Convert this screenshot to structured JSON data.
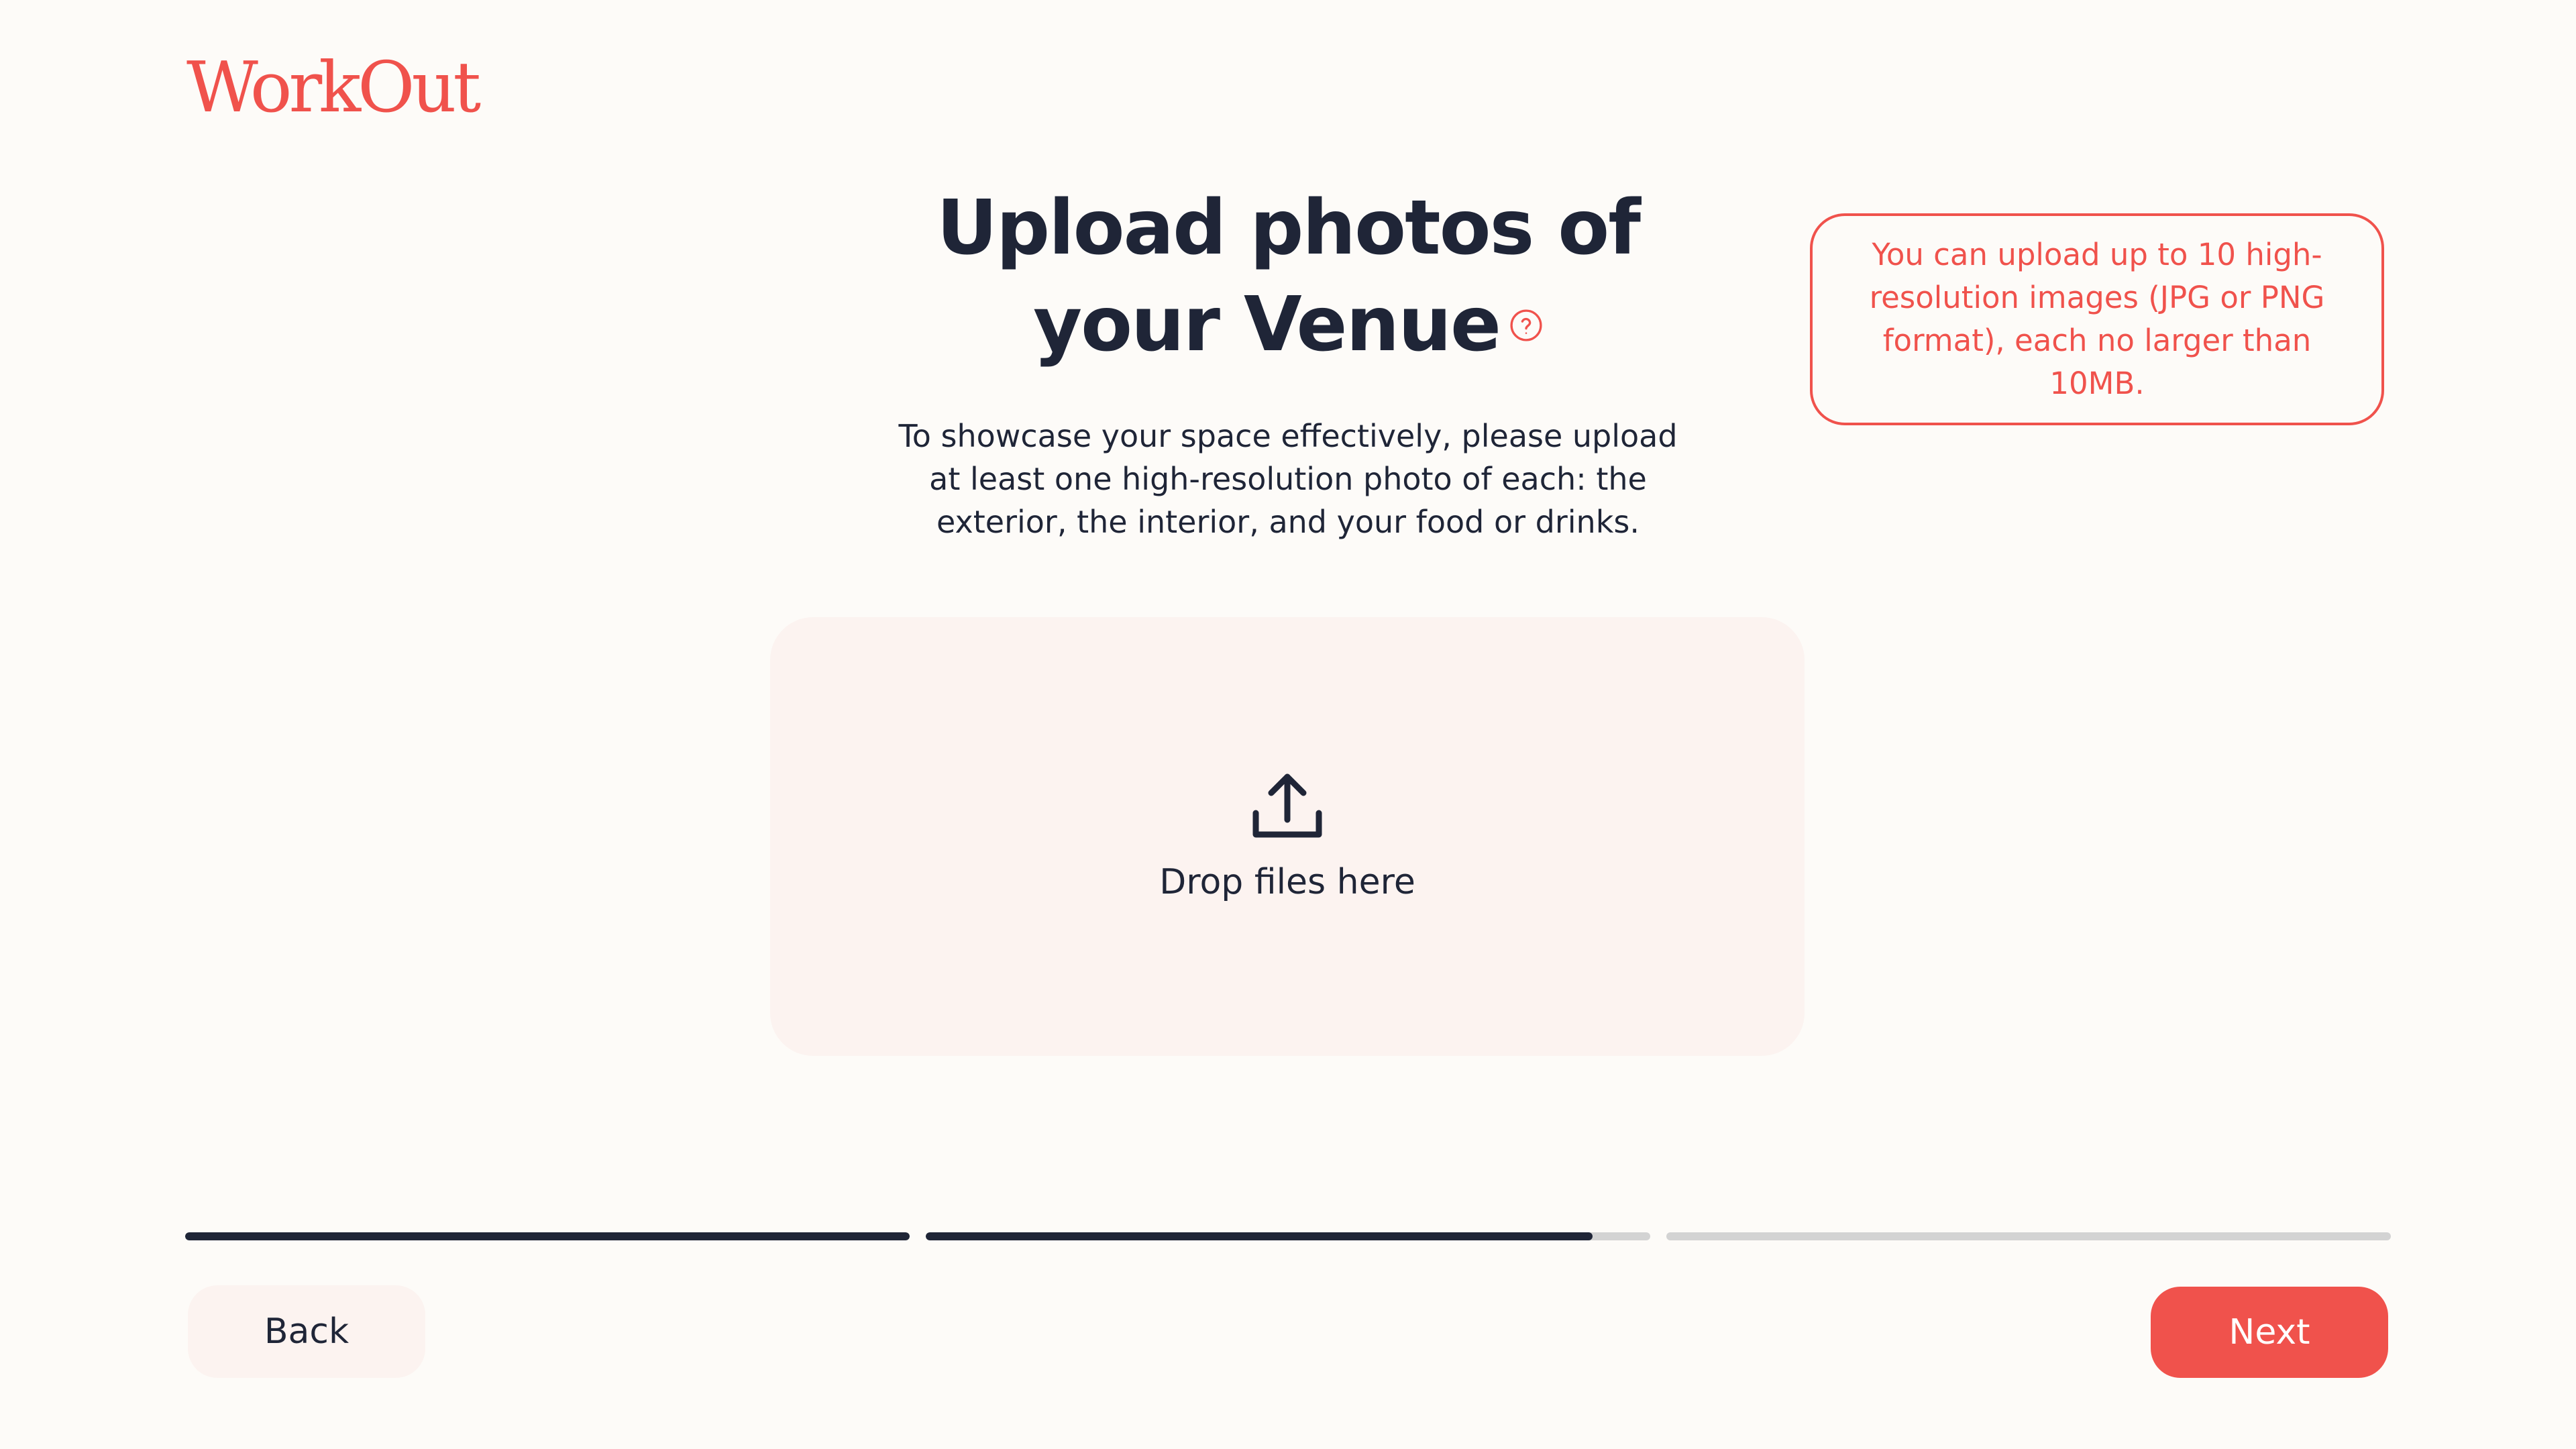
{
  "brand": {
    "logo_text": "WorkOut",
    "accent_color": "#F0524C",
    "text_color": "#1F2537",
    "background_color": "#FDFBF8"
  },
  "header": {
    "title_line1": "Upload photos of",
    "title_line2": "your Venue",
    "help_icon": "question-circle-icon",
    "subtitle": "To showcase your space effectively, please upload at least one high-resolution photo of each: the exterior, the interior, and your food or drinks."
  },
  "info": {
    "text": "You can upload up to 10 high-resolution images (JPG or PNG format), each no larger than 10MB."
  },
  "dropzone": {
    "icon": "upload-icon",
    "label": "Drop files here"
  },
  "progress": {
    "steps": [
      {
        "fill": 1.0
      },
      {
        "fill": 0.92
      },
      {
        "fill": 0.0
      }
    ]
  },
  "footer": {
    "back_label": "Back",
    "next_label": "Next"
  }
}
